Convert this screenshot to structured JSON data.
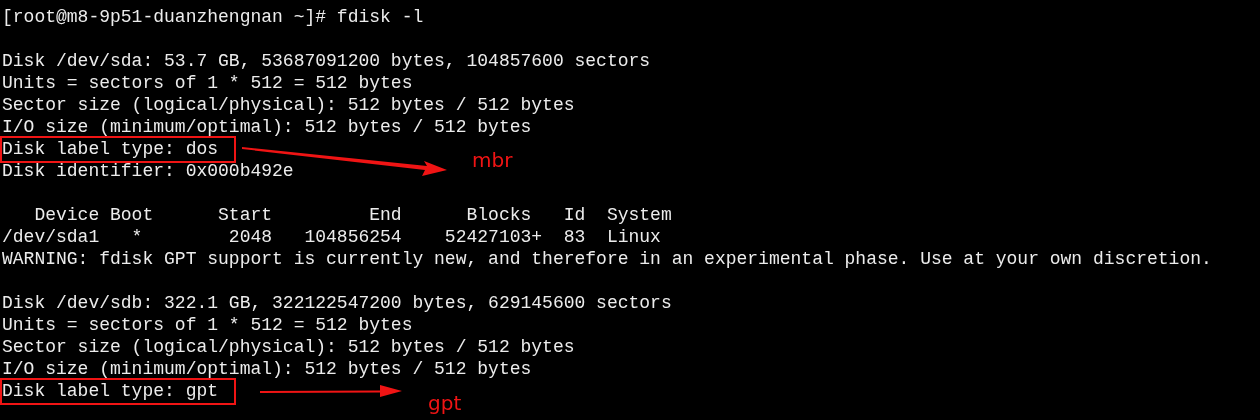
{
  "blocks": [
    {
      "lines": [
        {
          "text": "[root@m8-9p51-duanzhengnan ~]# fdisk -l"
        }
      ]
    },
    {
      "lines": [
        {
          "text": "Disk /dev/sda: 53.7 GB, 53687091200 bytes, 104857600 sectors"
        },
        {
          "text": "Units = sectors of 1 * 512 = 512 bytes"
        },
        {
          "text": "Sector size (logical/physical): 512 bytes / 512 bytes"
        },
        {
          "text": "I/O size (minimum/optimal): 512 bytes / 512 bytes"
        },
        {
          "text": "Disk label type: dos",
          "note": "mbr"
        },
        {
          "text": "Disk identifier: 0x000b492e"
        }
      ]
    },
    {
      "lines": [
        {
          "text": "   Device Boot      Start         End      Blocks   Id  System"
        },
        {
          "text": "/dev/sda1   *        2048   104856254    52427103+  83  Linux"
        },
        {
          "text": "WARNING: fdisk GPT support is currently new, and therefore in an experimental phase. Use at your own discretion."
        }
      ]
    },
    {
      "lines": [
        {
          "text": "Disk /dev/sdb: 322.1 GB, 322122547200 bytes, 629145600 sectors"
        },
        {
          "text": "Units = sectors of 1 * 512 = 512 bytes"
        },
        {
          "text": "Sector size (logical/physical): 512 bytes / 512 bytes"
        },
        {
          "text": "I/O size (minimum/optimal): 512 bytes / 512 bytes"
        },
        {
          "text": "Disk label type: gpt",
          "note": "gpt"
        }
      ]
    }
  ]
}
